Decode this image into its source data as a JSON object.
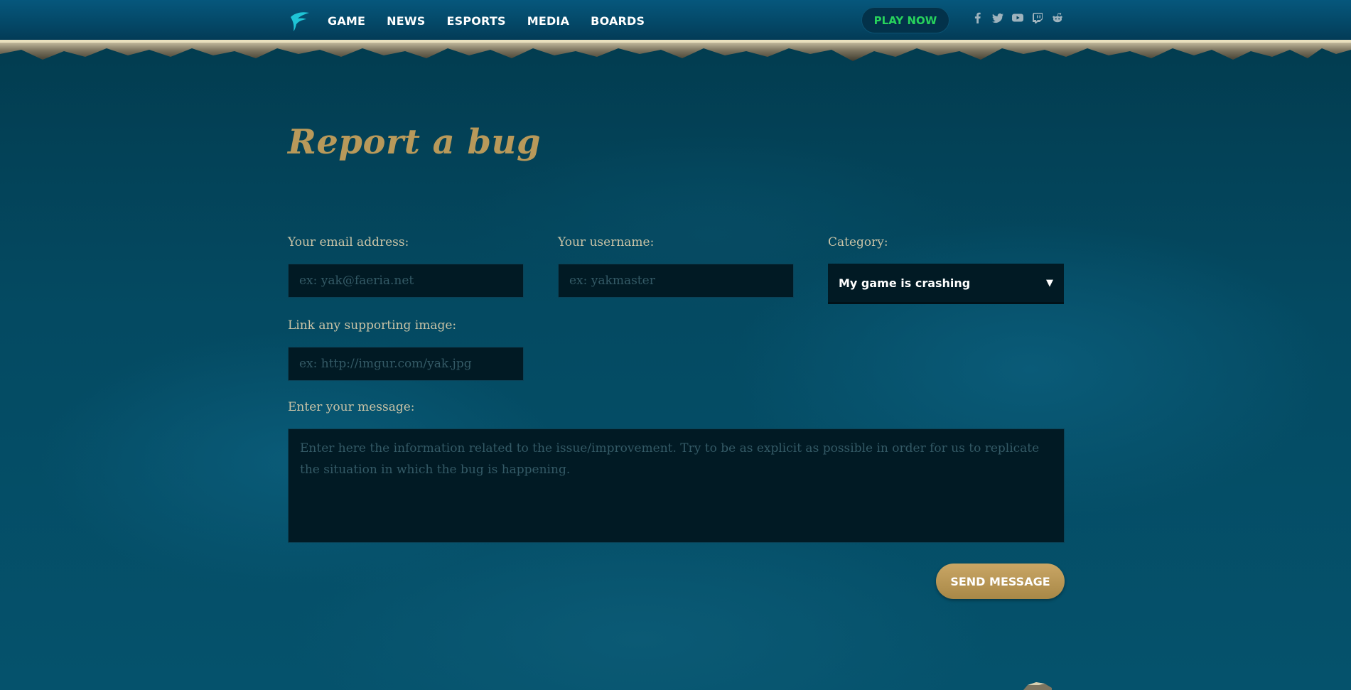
{
  "header": {
    "nav": [
      "GAME",
      "NEWS",
      "ESPORTS",
      "MEDIA",
      "BOARDS"
    ],
    "play_now": "PLAY NOW",
    "socials": [
      "facebook-icon",
      "twitter-icon",
      "youtube-icon",
      "twitch-icon",
      "reddit-icon"
    ]
  },
  "form": {
    "title": "Report a bug",
    "email_label": "Your email address:",
    "email_placeholder": "ex: yak@faeria.net",
    "username_label": "Your username:",
    "username_placeholder": "ex: yakmaster",
    "category_label": "Category:",
    "category_value": "My game is crashing",
    "image_label": "Link any supporting image:",
    "image_placeholder": "ex: http://imgur.com/yak.jpg",
    "message_label": "Enter your message:",
    "message_placeholder": "Enter here the information related to the issue/improvement. Try to be as explicit as possible in order for us to replicate the situation in which the bug is happening.",
    "send_label": "SEND MESSAGE"
  },
  "colors": {
    "background": "#033e52",
    "title_gold": "#b8995a",
    "play_green": "#27d35c",
    "field_bg": "#011a24"
  }
}
